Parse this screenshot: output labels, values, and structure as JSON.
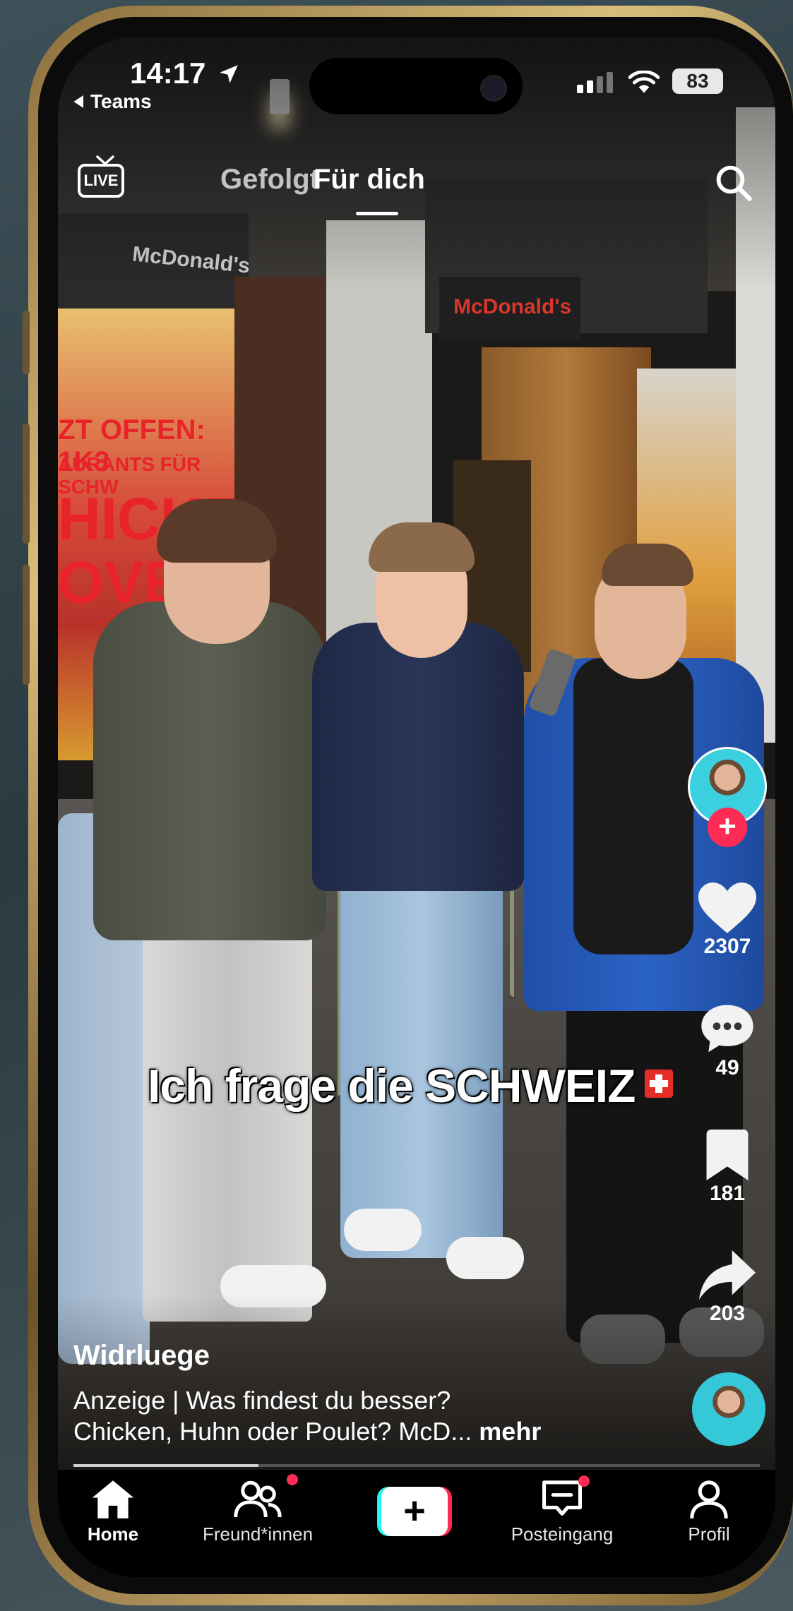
{
  "status_bar": {
    "time": "14:17",
    "back_label": "Teams",
    "battery": "83",
    "icons": [
      "location-arrow-icon",
      "signal-icon",
      "wifi-icon",
      "battery-icon"
    ]
  },
  "top_nav": {
    "live_label": "LIVE",
    "tabs": [
      {
        "label": "Gefolgt",
        "active": false
      },
      {
        "label": "Für dich",
        "active": true
      }
    ],
    "search_icon": "search-icon"
  },
  "video": {
    "caption": "Ich frage die SCHWEIZ",
    "caption_emoji": "swiss-flag-icon",
    "progress_fraction": 0.27
  },
  "actions": {
    "likes": "2307",
    "comments": "49",
    "bookmarks": "181",
    "shares": "203"
  },
  "post": {
    "author": "Widrluege",
    "description_line1": "Anzeige | Was findest du besser?",
    "description_line2": "Chicken, Huhn oder Poulet?  McD...",
    "more_label": "mehr"
  },
  "tab_bar": {
    "items": [
      {
        "label": "Home",
        "icon": "home-icon",
        "active": true
      },
      {
        "label": "Freund*innen",
        "icon": "friends-icon",
        "active": false,
        "badge": true
      },
      {
        "label": "",
        "icon": "create-plus-icon",
        "active": false
      },
      {
        "label": "Posteingang",
        "icon": "inbox-icon",
        "active": false,
        "badge": true
      },
      {
        "label": "Profil",
        "icon": "profile-icon",
        "active": false
      }
    ]
  },
  "colors": {
    "accent_red": "#fe2c55",
    "accent_cyan": "#25f4ee",
    "tab_bar_bg": "#000000"
  }
}
